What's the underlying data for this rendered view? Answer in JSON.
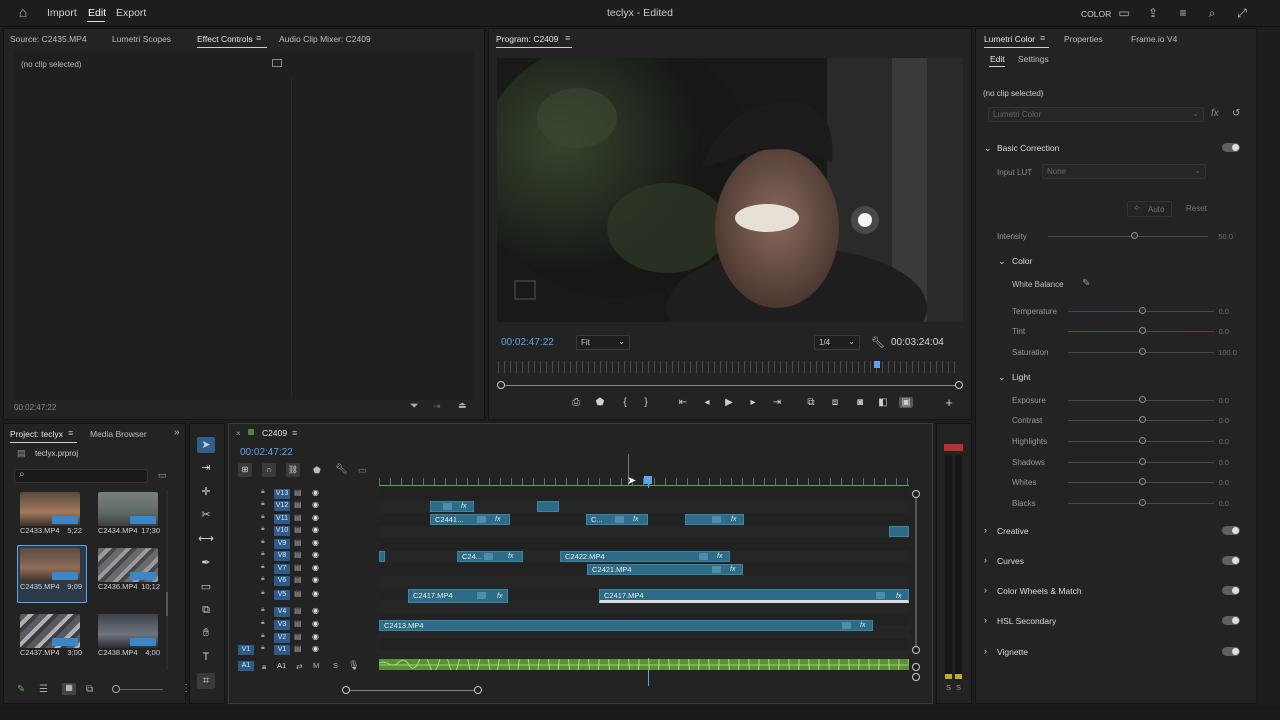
{
  "app": {
    "menu": [
      "Import",
      "Edit",
      "Export"
    ],
    "title": "teclyx - Edited",
    "workspace": "COLOR"
  },
  "source_panel": {
    "tabs": [
      "Source: C2435.MP4",
      "Lumetri Scopes",
      "Effect Controls",
      "Audio Clip Mixer: C2409"
    ],
    "active_tab": "Effect Controls",
    "no_clip": "(no clip selected)",
    "timecode": "00:02:47:22"
  },
  "program": {
    "title": "Program: C2409",
    "timecode": "00:02:47:22",
    "fit": "Fit",
    "resolution": "1/4",
    "duration": "00:03:24:04",
    "playhead_fraction": 0.82
  },
  "lumetri": {
    "tabs": [
      "Lumetri Color",
      "Properties",
      "Frame.io V4"
    ],
    "subtabs": [
      "Edit",
      "Settings"
    ],
    "no_clip": "(no clip selected)",
    "effect_select": "Lumetri Color",
    "basic_correction": "Basic Correction",
    "input_lut_label": "Input LUT",
    "input_lut_value": "None",
    "auto": "Auto",
    "reset": "Reset",
    "intensity": {
      "label": "Intensity",
      "value": "50.0"
    },
    "color_section": "Color",
    "white_balance": "White Balance",
    "color_sliders": [
      {
        "label": "Temperature",
        "value": "0.0"
      },
      {
        "label": "Tint",
        "value": "0.0"
      },
      {
        "label": "Saturation",
        "value": "100.0"
      }
    ],
    "light_section": "Light",
    "light_sliders": [
      {
        "label": "Exposure",
        "value": "0.0"
      },
      {
        "label": "Contrast",
        "value": "0.0"
      },
      {
        "label": "Highlights",
        "value": "0.0"
      },
      {
        "label": "Shadows",
        "value": "0.0"
      },
      {
        "label": "Whites",
        "value": "0.0"
      },
      {
        "label": "Blacks",
        "value": "0.0"
      }
    ],
    "sections": [
      "Creative",
      "Curves",
      "Color Wheels & Match",
      "HSL Secondary",
      "Vignette"
    ]
  },
  "project": {
    "tabs": [
      "Project: teclyx",
      "Media Browser"
    ],
    "file": "teclyx.prproj",
    "items": [
      {
        "name": "C2433.MP4",
        "dur": "5;22"
      },
      {
        "name": "C2434.MP4",
        "dur": "17;30"
      },
      {
        "name": "C2435.MP4",
        "dur": "9;09"
      },
      {
        "name": "C2436.MP4",
        "dur": "10;12"
      },
      {
        "name": "C2437.MP4",
        "dur": "3;00"
      },
      {
        "name": "C2438.MP4",
        "dur": "4;00"
      }
    ]
  },
  "timeline": {
    "sequence": "C2409",
    "timecode": "00:02:47:22",
    "tracks": [
      "V13",
      "V12",
      "V11",
      "V10",
      "V9",
      "V8",
      "V7",
      "V6",
      "V5",
      "V4",
      "V3",
      "V2",
      "V1",
      "A1"
    ],
    "src_v1": "V1",
    "src_a1": "A1",
    "track_a1": "A1",
    "mute": "M",
    "solo": "S",
    "clips": {
      "c2441": "C2441...",
      "c_short": "C...",
      "c24": "C24...",
      "c2422": "C2422.MP4",
      "c2421": "C2421.MP4",
      "c2417a": "C2417.MP4",
      "c2417b": "C2417.MP4",
      "c2413": "C2413.MP4"
    },
    "fx": "fx"
  },
  "meter": {
    "labels": [
      "S",
      "S"
    ]
  }
}
